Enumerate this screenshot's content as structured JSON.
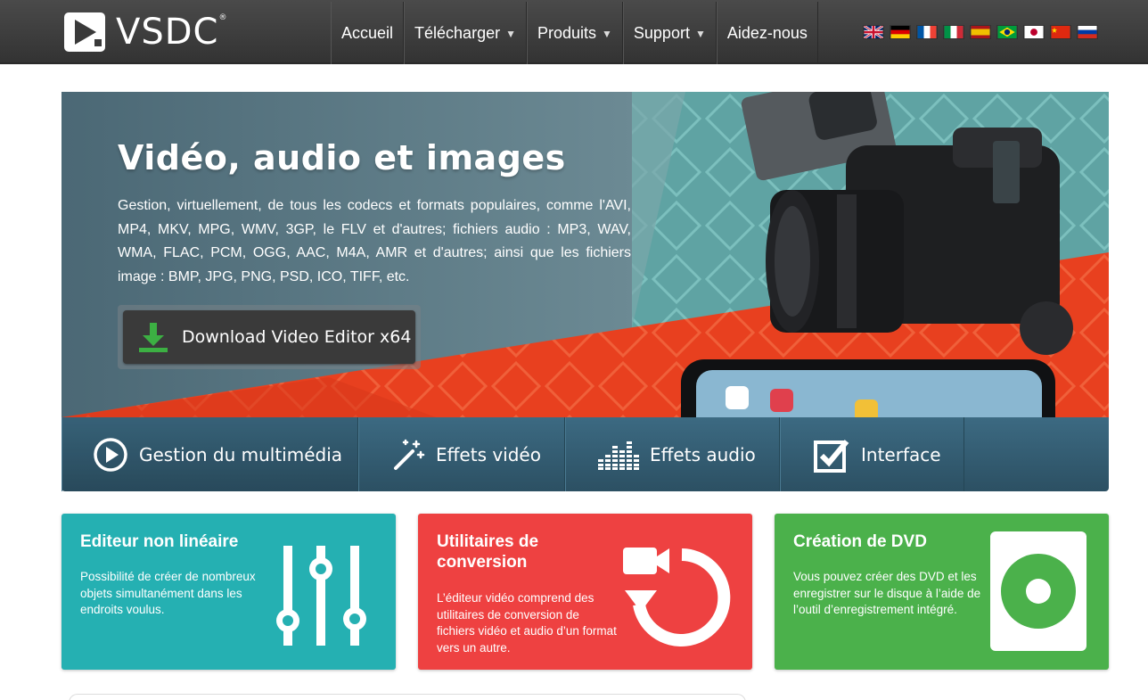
{
  "brand": {
    "name": "VSDC",
    "trademark": "®",
    "logo_icon": "vsdc-logo-icon"
  },
  "nav": {
    "items": [
      {
        "label": "Accueil",
        "has_dropdown": false
      },
      {
        "label": "Télécharger",
        "has_dropdown": true
      },
      {
        "label": "Produits",
        "has_dropdown": true
      },
      {
        "label": "Support",
        "has_dropdown": true
      },
      {
        "label": "Aidez-nous",
        "has_dropdown": false
      }
    ],
    "dropdown_icon": "chevron-down-icon",
    "languages": [
      "English",
      "Deutsch",
      "Français",
      "Italiano",
      "Español",
      "Português",
      "日本語",
      "中文",
      "Русский"
    ]
  },
  "hero": {
    "title": "Vidéo, audio et images",
    "description": "Gestion, virtuellement, de tous les codecs et formats populaires, comme l'AVI, MP4, MKV, MPG, WMV, 3GP, le FLV et d'autres; fichiers audio : MP3, WAV, WMA, FLAC, PCM, OGG, AAC, M4A, AMR et d'autres; ainsi que les fichiers image : BMP, JPG, PNG, PSD, ICO, TIFF, etc.",
    "download_button": "Download Video Editor x64",
    "download_icon": "download-arrow-icon"
  },
  "tabs": [
    {
      "label": "Gestion du multimédia",
      "icon": "play-circle-icon"
    },
    {
      "label": "Effets vidéo",
      "icon": "magic-wand-icon"
    },
    {
      "label": "Effets audio",
      "icon": "equalizer-icon"
    },
    {
      "label": "Interface",
      "icon": "checkbox-edit-icon"
    }
  ],
  "cards": [
    {
      "title": "Editeur non linéaire",
      "text": "Possibilité de créer de nombreux objets simultanément dans les endroits voulus.",
      "icon": "sliders-icon",
      "color": "#25b0b2"
    },
    {
      "title": "Utilitaires de conversion",
      "text": "L’éditeur vidéo comprend des utilitaires de conversion de fichiers vidéo et audio d’un format vers un autre.",
      "icon": "video-convert-icon",
      "color": "#ee4141"
    },
    {
      "title": "Création de DVD",
      "text": "Vous pouvez créer des DVD et les enregistrer sur le disque à l’aide de l’outil d’enregistrement intégré.",
      "icon": "dvd-disc-icon",
      "color": "#4bb14b"
    }
  ],
  "colors": {
    "topbar": "#3a3a3a",
    "tabs": "#2f5a6e",
    "download_green": "#3cb043"
  }
}
